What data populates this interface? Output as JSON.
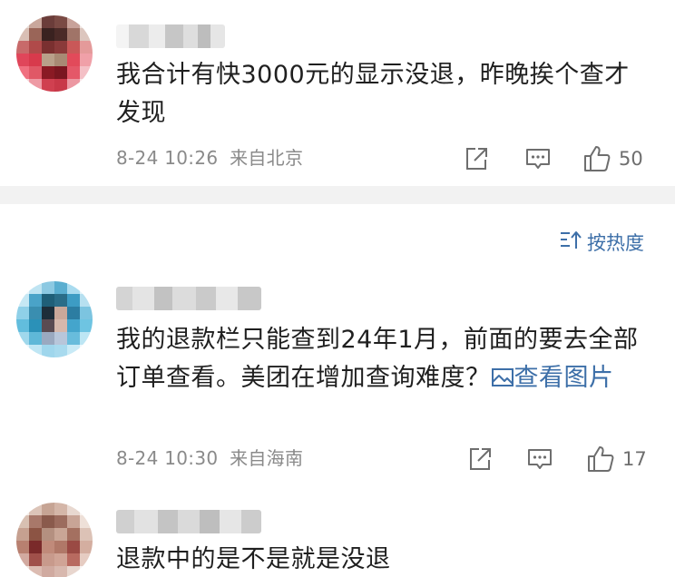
{
  "comments": [
    {
      "text": "我合计有快3000元的显示没退，昨晚挨个查才发现",
      "time": "8-24 10:26",
      "location": "来自北京",
      "likes": "50"
    },
    {
      "text": "我的退款栏只能查到24年1月，前面的要去全部订单查看。美团在增加查询难度？",
      "link_label": "查看图片",
      "time": "8-24 10:30",
      "location": "来自海南",
      "likes": "17"
    },
    {
      "text": "退款中的是不是就是没退"
    }
  ],
  "sort": {
    "label": "按热度"
  },
  "icons": {
    "share": "share-icon",
    "comment": "comment-icon",
    "like": "thumbs-up-icon",
    "sort": "sort-icon",
    "image": "image-icon"
  },
  "colors": {
    "link": "#3d6fa8",
    "meta": "#8a8a8a",
    "divider": "#f2f2f2"
  }
}
